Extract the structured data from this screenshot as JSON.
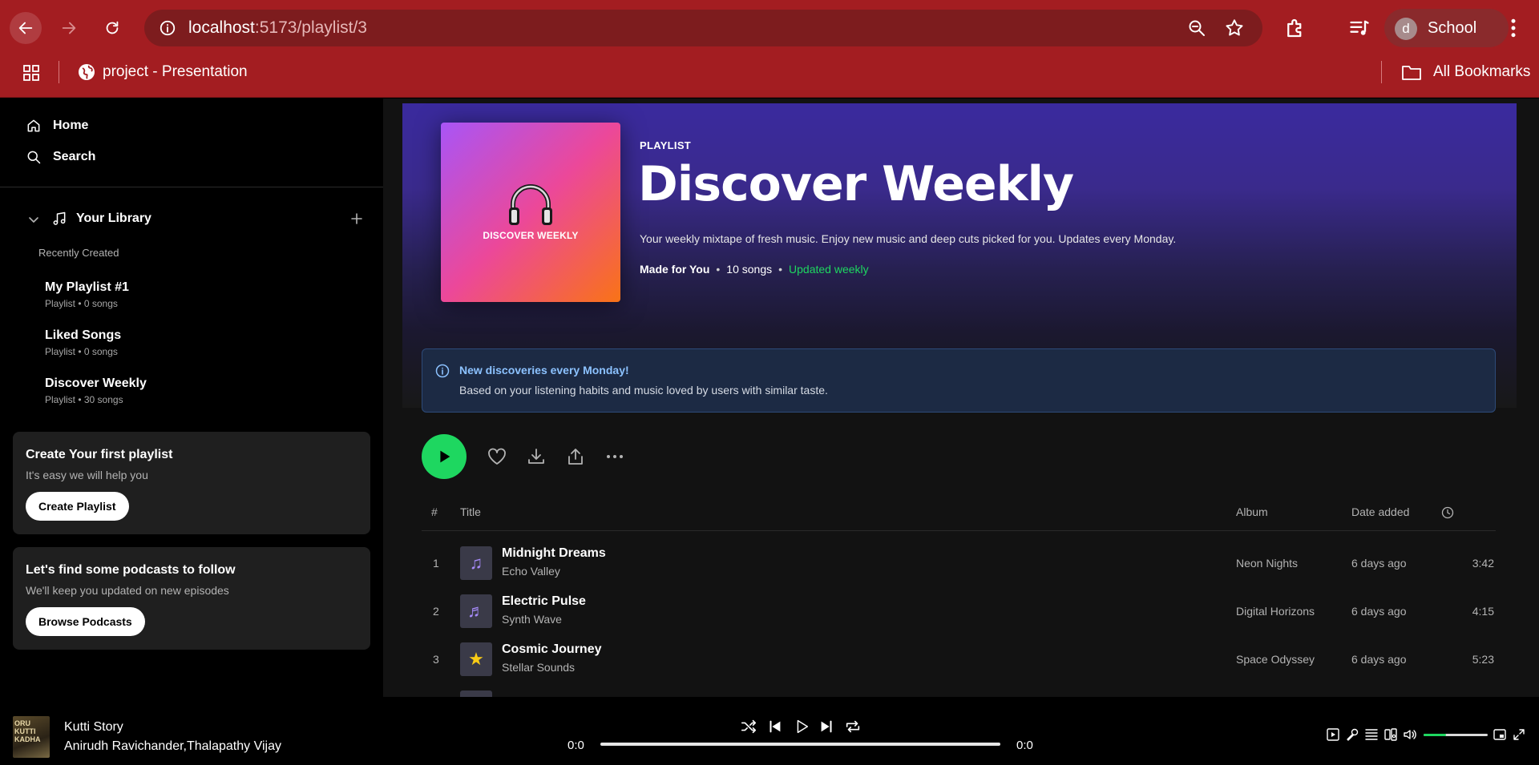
{
  "browser": {
    "url_host": "localhost",
    "url_path": ":5173/playlist/3",
    "profile_initial": "d",
    "profile_name": "School",
    "bookmark_label": "project - Presentation",
    "all_bookmarks_label": "All Bookmarks"
  },
  "sidebar": {
    "nav": [
      {
        "label": "Home",
        "icon": "home-icon"
      },
      {
        "label": "Search",
        "icon": "search-icon"
      }
    ],
    "library_title": "Your Library",
    "recent_label": "Recently Created",
    "playlists": [
      {
        "name": "My Playlist #1",
        "meta": "Playlist • 0 songs"
      },
      {
        "name": "Liked Songs",
        "meta": "Playlist • 0 songs"
      },
      {
        "name": "Discover Weekly",
        "meta": "Playlist • 30 songs"
      }
    ],
    "create_card": {
      "title": "Create Your first playlist",
      "subtitle": "It's easy we will help you",
      "button": "Create Playlist"
    },
    "podcast_card": {
      "title": "Let's find some podcasts to follow",
      "subtitle": "We'll keep you updated on new episodes",
      "button": "Browse Podcasts"
    }
  },
  "playlist": {
    "type_label": "PLAYLIST",
    "title": "Discover Weekly",
    "cover_text": "DISCOVER WEEKLY",
    "description": "Your weekly mixtape of fresh music. Enjoy new music and deep cuts picked for you. Updates every Monday.",
    "meta_owner": "Made for You",
    "meta_songs": "10 songs",
    "meta_updated": "Updated weekly",
    "accent_color": "#1ed760"
  },
  "info_banner": {
    "title": "New discoveries every Monday!",
    "subtitle": "Based on your listening habits and music loved by users with similar taste."
  },
  "track_table": {
    "headers": {
      "num": "#",
      "title": "Title",
      "album": "Album",
      "date": "Date added"
    },
    "tracks": [
      {
        "num": "1",
        "art_icon": "♫",
        "name": "Midnight Dreams",
        "artist": "Echo Valley",
        "album": "Neon Nights",
        "date": "6 days ago",
        "duration": "3:42"
      },
      {
        "num": "2",
        "art_icon": "♬",
        "name": "Electric Pulse",
        "artist": "Synth Wave",
        "album": "Digital Horizons",
        "date": "6 days ago",
        "duration": "4:15"
      },
      {
        "num": "3",
        "art_icon": "★",
        "name": "Cosmic Journey",
        "artist": "Stellar Sounds",
        "album": "Space Odyssey",
        "date": "6 days ago",
        "duration": "5:23"
      }
    ]
  },
  "player": {
    "art_text": "ORU KUTTI KADHA",
    "track": "Kutti Story",
    "artist": "Anirudh Ravichander,Thalapathy Vijay",
    "time_current": "0:0",
    "time_total": "0:0",
    "volume_fraction": 0.35
  }
}
